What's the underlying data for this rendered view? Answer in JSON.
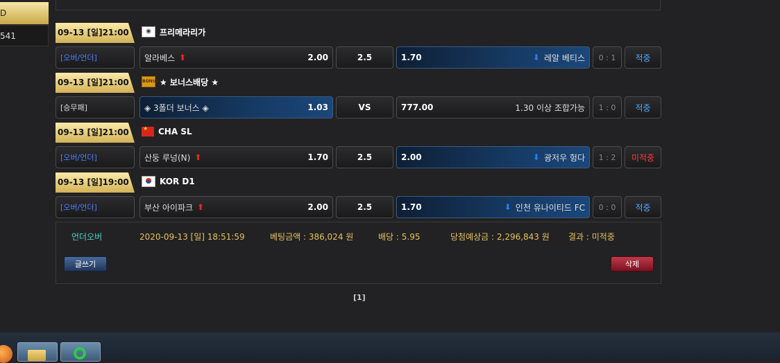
{
  "sidebar": {
    "gold_text": "D",
    "dark_text": "541"
  },
  "bets": [
    {
      "date": "09-13 [일]21:00",
      "league": "프리메라리가",
      "flag_icon": "soccer-ball-flag",
      "type": "[오버/언더]",
      "home": "알라베스",
      "home_odds": "2.00",
      "mid": "2.5",
      "away_odds": "1.70",
      "away": "레알 베티스",
      "score": "0 : 1",
      "result": "적중"
    },
    {
      "date": "09-13 [일]21:00",
      "league": "★ 보너스배당 ★",
      "flag_icon": "bonus-flag",
      "type": "[승무패]",
      "home": "◈ 3폴더 보너스 ◈",
      "home_odds": "1.03",
      "mid": "VS",
      "away_odds": "777.00",
      "away": "1.30 이상 조합가능",
      "score": "1 : 0",
      "result": "적중"
    },
    {
      "date": "09-13 [일]21:00",
      "league": "CHA SL",
      "flag_icon": "china-flag",
      "type": "[오버/언더]",
      "home": "산둥 루넝(N)",
      "home_odds": "1.70",
      "mid": "2.5",
      "away_odds": "2.00",
      "away": "광저우 헝다",
      "score": "1 : 2",
      "result": "미적중"
    },
    {
      "date": "09-13 [일]19:00",
      "league": "KOR D1",
      "flag_icon": "korea-flag",
      "type": "[오버/언더]",
      "home": "부산 아이파크",
      "home_odds": "2.00",
      "mid": "2.5",
      "away_odds": "1.70",
      "away": "인천 유나이티드 FC",
      "score": "0 : 0",
      "result": "적중"
    }
  ],
  "summary": {
    "bet_type": "언더오버",
    "datetime": "2020-09-13 [일] 18:51:59",
    "amount": "베팅금액 : 386,024 원",
    "odds": "배당 : 5.95",
    "expected": "당첨예상금 : 2,296,843 원",
    "result": "결과 : 미적중"
  },
  "buttons": {
    "write": "글쓰기",
    "delete": "삭제"
  },
  "pager": "[1]",
  "colors": {
    "hit": "#4fa8ff",
    "miss": "#ff3c3c",
    "gold": "#e6c15a"
  }
}
